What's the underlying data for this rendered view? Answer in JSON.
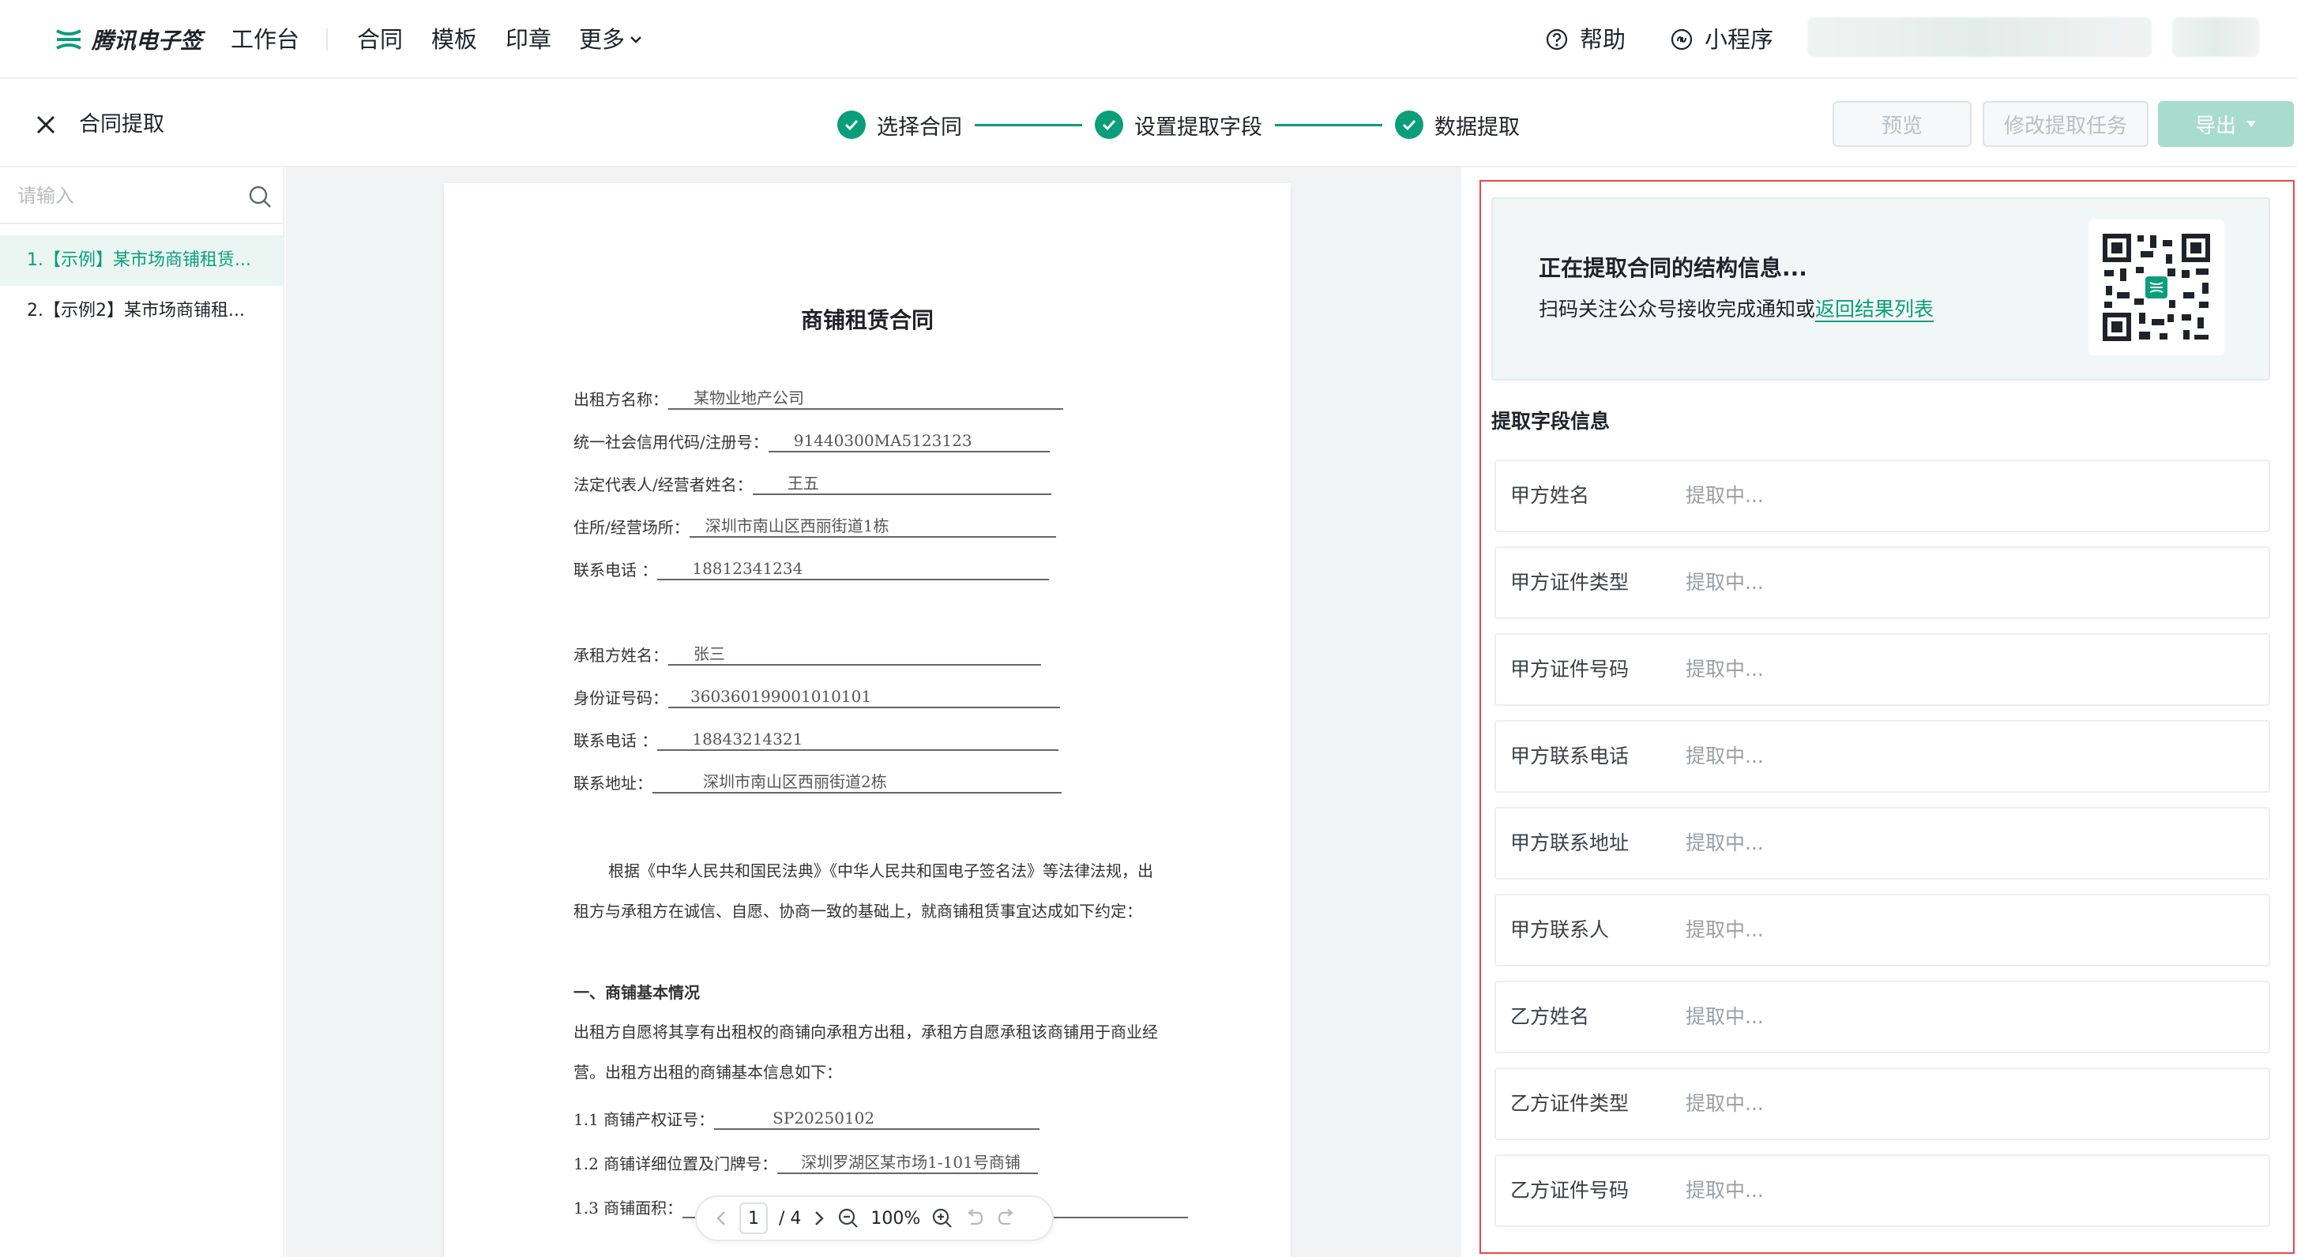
{
  "app": {
    "logo_text": "腾讯电子签"
  },
  "topnav": {
    "items": [
      "工作台",
      "合同",
      "模板",
      "印章",
      "更多"
    ],
    "help": "帮助",
    "miniprogram": "小程序"
  },
  "subbar": {
    "title": "合同提取",
    "steps": [
      "选择合同",
      "设置提取字段",
      "数据提取"
    ],
    "buttons": {
      "preview": "预览",
      "modify": "修改提取任务",
      "export": "导出"
    }
  },
  "sidebar": {
    "search_placeholder": "请输入",
    "files": [
      {
        "label": "1.【示例】某市场商铺租赁...",
        "active": true
      },
      {
        "label": "2.【示例2】某市场商铺租...",
        "active": false
      }
    ]
  },
  "document": {
    "title": "商铺租赁合同",
    "lessor": [
      {
        "label": "出租方名称：",
        "value": "某物业地产公司"
      },
      {
        "label": "统一社会信用代码/注册号：",
        "value": "91440300MA5123123"
      },
      {
        "label": "法定代表人/经营者姓名：",
        "value": "王五"
      },
      {
        "label": "住所/经营场所：",
        "value": "深圳市南山区西丽街道1栋"
      },
      {
        "label": "联系电话 ：",
        "value": "18812341234"
      }
    ],
    "lessee": [
      {
        "label": "承租方姓名：",
        "value": "张三"
      },
      {
        "label": "身份证号码：",
        "value": "360360199001010101"
      },
      {
        "label": "联系电话 ：",
        "value": "18843214321"
      },
      {
        "label": "联系地址：",
        "value": "深圳市南山区西丽街道2栋"
      }
    ],
    "para1": "根据《中华人民共和国民法典》《中华人民共和国电子签名法》等法律法规，出租方与承租方在诚信、自愿、协商一致的基础上，就商铺租赁事宜达成如下约定：",
    "section1": "一、商铺基本情况",
    "para2": "出租方自愿将其享有出租权的商铺向承租方出租，承租方自愿承租该商铺用于商业经营。出租方出租的商铺基本信息如下：",
    "item11": {
      "label": "1.1 商铺产权证号：",
      "value": "SP20250102"
    },
    "item12": {
      "label": "1.2 商铺详细位置及门牌号：",
      "value": "深圳罗湖区某市场1-101号商铺"
    },
    "item13": {
      "label": "1.3 商铺面积：",
      "value": ""
    }
  },
  "pager": {
    "current": "1",
    "total": "/ 4",
    "zoom": "100%"
  },
  "extract": {
    "notice_title": "正在提取合同的结构信息...",
    "notice_sub": "扫码关注公众号接收完成通知或",
    "notice_link": "返回结果列表",
    "fields_title": "提取字段信息",
    "fields": [
      {
        "name": "甲方姓名",
        "value": "提取中..."
      },
      {
        "name": "甲方证件类型",
        "value": "提取中..."
      },
      {
        "name": "甲方证件号码",
        "value": "提取中..."
      },
      {
        "name": "甲方联系电话",
        "value": "提取中..."
      },
      {
        "name": "甲方联系地址",
        "value": "提取中..."
      },
      {
        "name": "甲方联系人",
        "value": "提取中..."
      },
      {
        "name": "乙方姓名",
        "value": "提取中..."
      },
      {
        "name": "乙方证件类型",
        "value": "提取中..."
      },
      {
        "name": "乙方证件号码",
        "value": "提取中..."
      }
    ]
  },
  "colors": {
    "accent": "#0a9e7b",
    "highlight_border": "#e5484d"
  }
}
